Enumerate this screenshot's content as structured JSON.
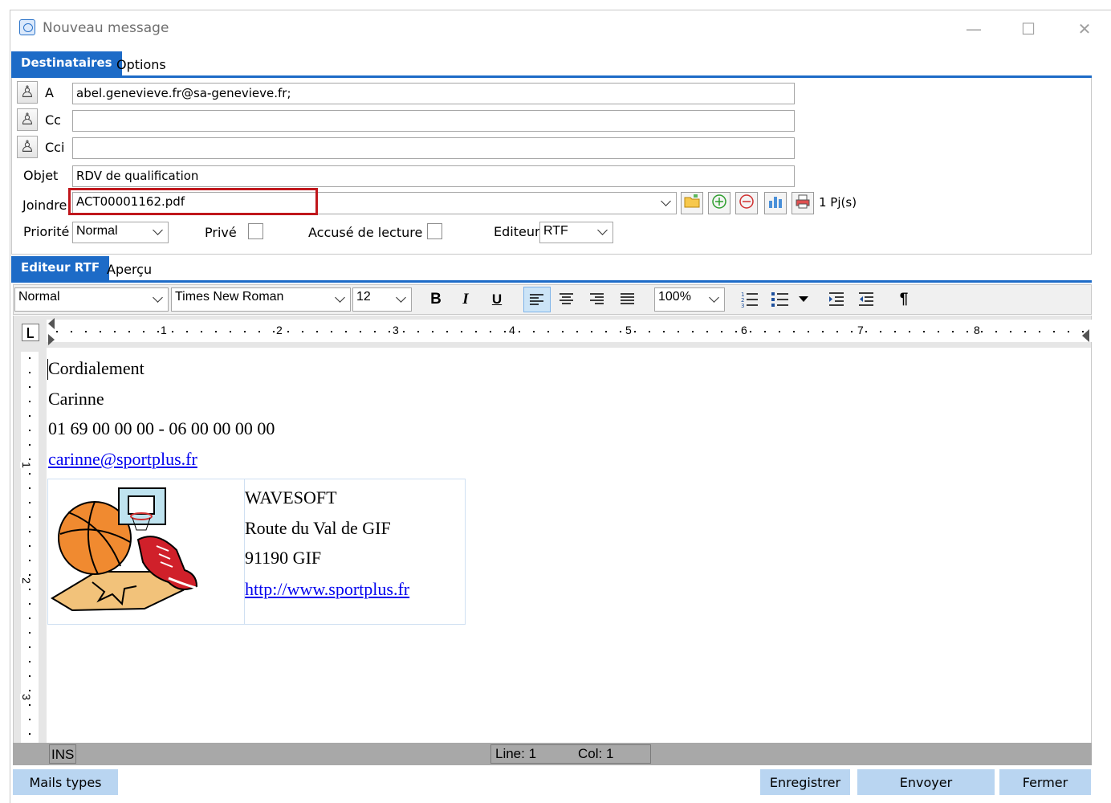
{
  "window": {
    "title": "Nouveau message"
  },
  "top_tabs": {
    "active": "Destinataires",
    "other": "Options"
  },
  "recipients": {
    "to_label": "A",
    "to_value": "abel.genevieve.fr@sa-genevieve.fr;",
    "cc_label": "Cc",
    "cc_value": "",
    "bcc_label": "Cci",
    "bcc_value": "",
    "subject_label": "Objet",
    "subject_value": "RDV de qualification",
    "attach_label": "Joindre",
    "attach_value": "ACT00001162.pdf",
    "attach_count": "1 Pj(s)"
  },
  "options_row": {
    "priority_label": "Priorité",
    "priority_value": "Normal",
    "private_label": "Privé",
    "read_receipt_label": "Accusé de lecture",
    "editor_label": "Editeur",
    "editor_value": "RTF"
  },
  "editor_tabs": {
    "active": "Editeur RTF",
    "other": "Aperçu"
  },
  "format_toolbar": {
    "style": "Normal",
    "font": "Times New Roman",
    "size": "12",
    "zoom": "100%",
    "bold": "B",
    "italic": "I",
    "underline": "U",
    "paragraph": "¶"
  },
  "ruler": {
    "numbers": [
      "1",
      "2",
      "3",
      "4",
      "5",
      "6",
      "7",
      "8"
    ],
    "side_numbers": [
      "1",
      "2",
      "3"
    ]
  },
  "body": {
    "line1": "Cordialement",
    "line2": "Carinne",
    "line3": "01 69 00 00 00 - 06 00 00 00 00",
    "email": "carinne@sportplus.fr",
    "company": "WAVESOFT",
    "address1": "Route du Val de GIF",
    "address2": "91190 GIF",
    "website": "http://www.sportplus.fr"
  },
  "status": {
    "mode": "INS",
    "line": "Line: 1",
    "col": "Col: 1"
  },
  "buttons": {
    "templates": "Mails types",
    "save": "Enregistrer",
    "send": "Envoyer",
    "close": "Fermer"
  },
  "colors": {
    "accent": "#1d6bc7",
    "button_bg": "#b9d5f1",
    "highlight": "#c0171c",
    "status_bar": "#a8a8a8"
  },
  "icons": [
    "app-icon",
    "minimize-icon",
    "maximize-icon",
    "close-icon",
    "address-book-icon",
    "open-folder-icon",
    "add-icon",
    "remove-icon",
    "chart-icon",
    "print-icon",
    "numbered-list-icon",
    "bullet-list-icon",
    "indent-icon",
    "outdent-icon",
    "tab-stop-icon"
  ]
}
